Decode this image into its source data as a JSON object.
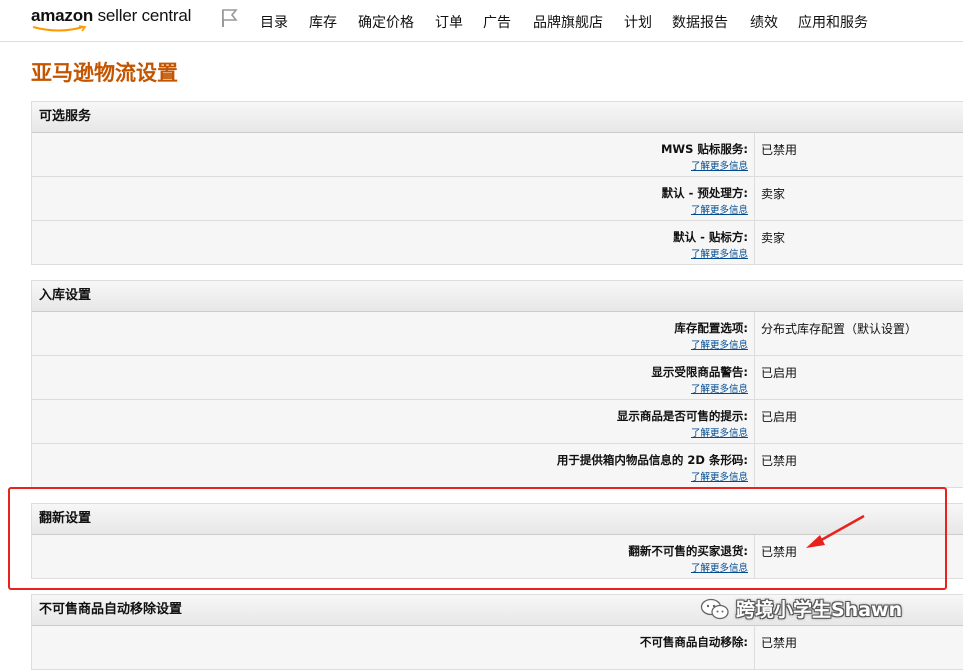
{
  "brand": {
    "name_bold": "amazon",
    "name_rest": " seller central"
  },
  "nav": [
    "目录",
    "库存",
    "确定价格",
    "订单",
    "广告",
    "品牌旗舰店",
    "计划",
    "数据报告",
    "绩效",
    "应用和服务"
  ],
  "page_title": "亚马逊物流设置",
  "sections": [
    {
      "title": "可选服务",
      "rows": [
        {
          "label": "MWS 贴标服务:",
          "more": "了解更多信息",
          "value": "已禁用"
        },
        {
          "label": "默认 - 预处理方:",
          "more": "了解更多信息",
          "value": "卖家"
        },
        {
          "label": "默认 - 贴标方:",
          "more": "了解更多信息",
          "value": "卖家"
        }
      ]
    },
    {
      "title": "入库设置",
      "rows": [
        {
          "label": "库存配置选项:",
          "more": "了解更多信息",
          "value": "分布式库存配置（默认设置）"
        },
        {
          "label": "显示受限商品警告:",
          "more": "了解更多信息",
          "value": "已启用"
        },
        {
          "label": "显示商品是否可售的提示:",
          "more": "了解更多信息",
          "value": "已启用"
        },
        {
          "label": "用于提供箱内物品信息的 2D 条形码:",
          "more": "了解更多信息",
          "value": "已禁用"
        }
      ]
    },
    {
      "title": "翻新设置",
      "rows": [
        {
          "label": "翻新不可售的买家退货:",
          "more": "了解更多信息",
          "value": "已禁用"
        }
      ]
    },
    {
      "title": "不可售商品自动移除设置",
      "rows": [
        {
          "label": "不可售商品自动移除:",
          "more": "",
          "value": "已禁用"
        }
      ]
    }
  ],
  "watermark": "跨境小学生Shawn",
  "colors": {
    "title": "#c45500",
    "link": "#004b91",
    "highlight": "#e8231d"
  }
}
